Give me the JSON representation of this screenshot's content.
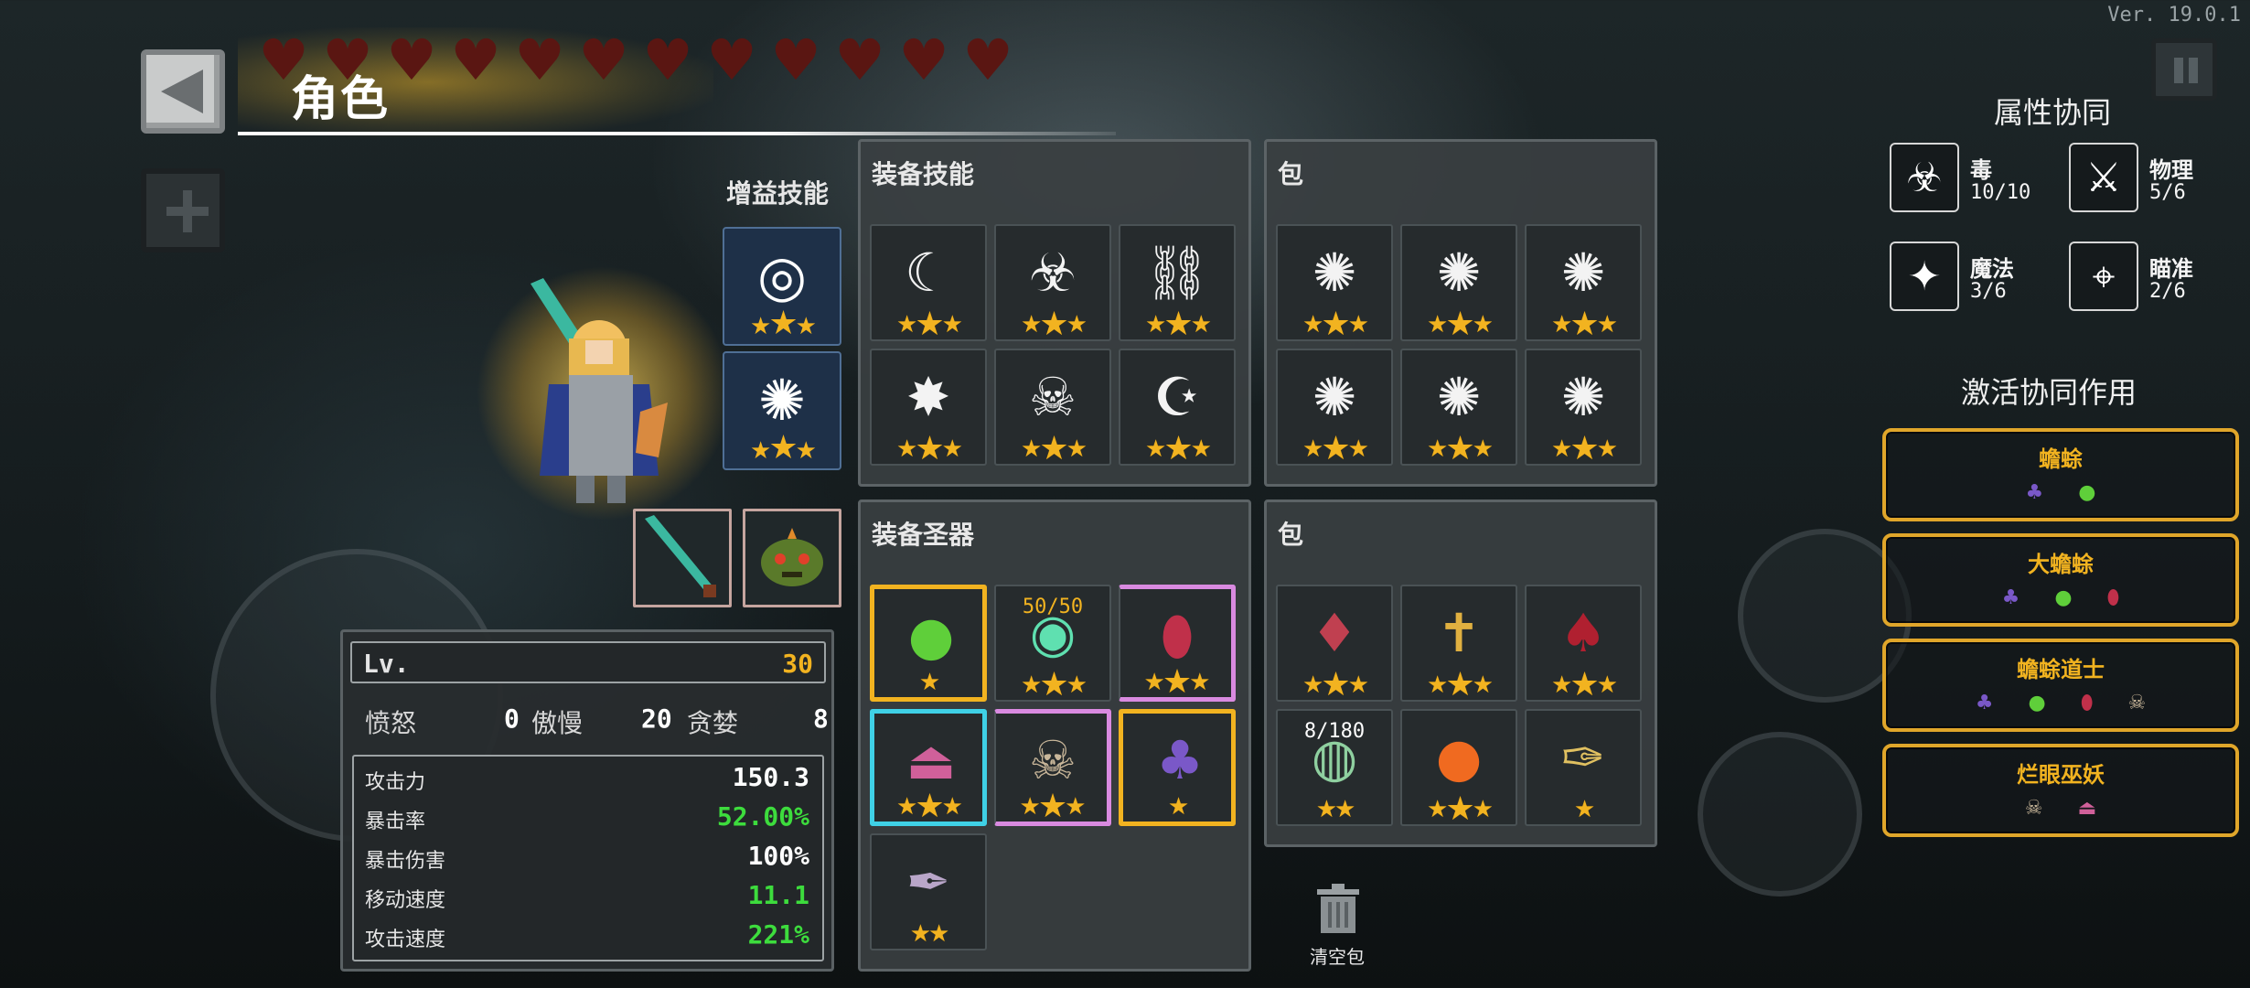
{
  "version": "Ver. 19.0.1",
  "header": {
    "title": "角色"
  },
  "hearts": {
    "count": 12
  },
  "buff_skills": {
    "label": "增益技能",
    "items": [
      {
        "icon": "spiral-orb-icon",
        "stars": 3
      },
      {
        "icon": "claw-biohazard-icon",
        "stars": 3
      }
    ]
  },
  "weapons": [
    {
      "icon": "green-sword-icon"
    },
    {
      "icon": "goblin-mask-icon"
    }
  ],
  "equipped_skills": {
    "title": "装备技能",
    "items": [
      {
        "icon": "crescent-moon-icon",
        "glyph": "☾",
        "stars": 3
      },
      {
        "icon": "biohazard-icon",
        "glyph": "☣",
        "stars": 3
      },
      {
        "icon": "chain-bone-icon",
        "glyph": "⛓",
        "stars": 3
      },
      {
        "icon": "burst-icon",
        "glyph": "✸",
        "stars": 3
      },
      {
        "icon": "skull-burst-icon",
        "glyph": "☠",
        "stars": 3
      },
      {
        "icon": "scythe-swirl-icon",
        "glyph": "☪",
        "stars": 3
      }
    ]
  },
  "skill_bag": {
    "title": "包",
    "items": [
      {
        "icon": "claw-biohazard-icon",
        "glyph": "✺",
        "stars": 3
      },
      {
        "icon": "claw-biohazard-icon",
        "glyph": "✺",
        "stars": 3
      },
      {
        "icon": "claw-biohazard-icon",
        "glyph": "✺",
        "stars": 3
      },
      {
        "icon": "claw-biohazard-icon",
        "glyph": "✺",
        "stars": 3
      },
      {
        "icon": "claw-biohazard-icon",
        "glyph": "✺",
        "stars": 3
      },
      {
        "icon": "claw-biohazard-icon",
        "glyph": "✺",
        "stars": 3
      }
    ]
  },
  "equipped_relics": {
    "title": "装备圣器",
    "items": [
      {
        "icon": "green-slime-drops-icon",
        "glyph": "●",
        "color": "#5fcf3a",
        "stars": 1,
        "count": ""
      },
      {
        "icon": "green-orb-icon",
        "glyph": "◉",
        "color": "#5fe0b0",
        "stars": 3,
        "count": "50/50"
      },
      {
        "icon": "red-egg-icon",
        "glyph": "⬮",
        "color": "#c0304a",
        "stars": 3,
        "count": ""
      },
      {
        "icon": "pink-potion-icon",
        "glyph": "⏏",
        "color": "#d0609a",
        "stars": 3,
        "count": ""
      },
      {
        "icon": "skull-icon",
        "glyph": "☠",
        "color": "#c9b79a",
        "stars": 3,
        "count": ""
      },
      {
        "icon": "purple-toad-icon",
        "glyph": "♣",
        "color": "#7a58c8",
        "stars": 1,
        "count": ""
      },
      {
        "icon": "dark-feather-icon",
        "glyph": "✒",
        "color": "#b9a6c9",
        "stars": 2,
        "count": ""
      }
    ]
  },
  "relic_bag": {
    "title": "包",
    "items": [
      {
        "icon": "red-crystal-icon",
        "glyph": "♦",
        "color": "#c04050",
        "stars": 3,
        "count": ""
      },
      {
        "icon": "golden-cross-sword-icon",
        "glyph": "✝",
        "color": "#e0b040",
        "stars": 3,
        "count": ""
      },
      {
        "icon": "red-demon-icon",
        "glyph": "♠",
        "color": "#b02030",
        "stars": 3,
        "count": ""
      },
      {
        "icon": "egg-nest-icon",
        "glyph": "◍",
        "color": "#8fd0a0",
        "stars": 2,
        "count": "8/180"
      },
      {
        "icon": "fire-orb-icon",
        "glyph": "●",
        "color": "#f06a20",
        "stars": 3,
        "count": ""
      },
      {
        "icon": "fountain-pen-icon",
        "glyph": "✑",
        "color": "#e0c060",
        "stars": 1,
        "count": ""
      }
    ]
  },
  "trash": {
    "label": "清空包"
  },
  "stats": {
    "lv_label": "Lv.",
    "lv_value": "30",
    "sins": [
      {
        "label": "愤怒",
        "value": "0"
      },
      {
        "label": "傲慢",
        "value": "20"
      },
      {
        "label": "贪婪",
        "value": "8"
      }
    ],
    "rows": [
      {
        "label": "攻击力",
        "value": "150.3",
        "color": "#ffffff"
      },
      {
        "label": "暴击率",
        "value": "52.00%",
        "color": "#3ddc3d"
      },
      {
        "label": "暴击伤害",
        "value": "100%",
        "color": "#ffffff"
      },
      {
        "label": "移动速度",
        "value": "11.1",
        "color": "#3ddc3d"
      },
      {
        "label": "攻击速度",
        "value": "221%",
        "color": "#3ddc3d"
      }
    ]
  },
  "attribute_synergy": {
    "title": "属性协同",
    "items": [
      {
        "name": "毒",
        "value": "10/10",
        "icon": "biohazard-icon",
        "glyph": "☣"
      },
      {
        "name": "物理",
        "value": "5/6",
        "icon": "sword-icon",
        "glyph": "⚔"
      },
      {
        "name": "魔法",
        "value": "3/6",
        "icon": "four-point-star-icon",
        "glyph": "✦"
      },
      {
        "name": "瞄准",
        "value": "2/6",
        "icon": "crosshair-icon",
        "glyph": "⌖"
      }
    ]
  },
  "active_synergy": {
    "title": "激活协同作用",
    "items": [
      {
        "name": "蟾蜍",
        "icons": [
          "purple-toad-icon",
          "green-slime-drops-icon"
        ]
      },
      {
        "name": "大蟾蜍",
        "icons": [
          "purple-toad-icon",
          "green-slime-drops-icon",
          "red-egg-icon"
        ]
      },
      {
        "name": "蟾蜍道士",
        "icons": [
          "purple-toad-icon",
          "green-slime-drops-icon",
          "red-egg-icon",
          "skull-icon"
        ]
      },
      {
        "name": "烂眼巫妖",
        "icons": [
          "skull-icon",
          "pink-potion-icon"
        ]
      }
    ]
  },
  "colors": {
    "accent_gold": "#f2b320",
    "positive_green": "#3ddc3d",
    "panel_bg": "#3a3f41"
  }
}
